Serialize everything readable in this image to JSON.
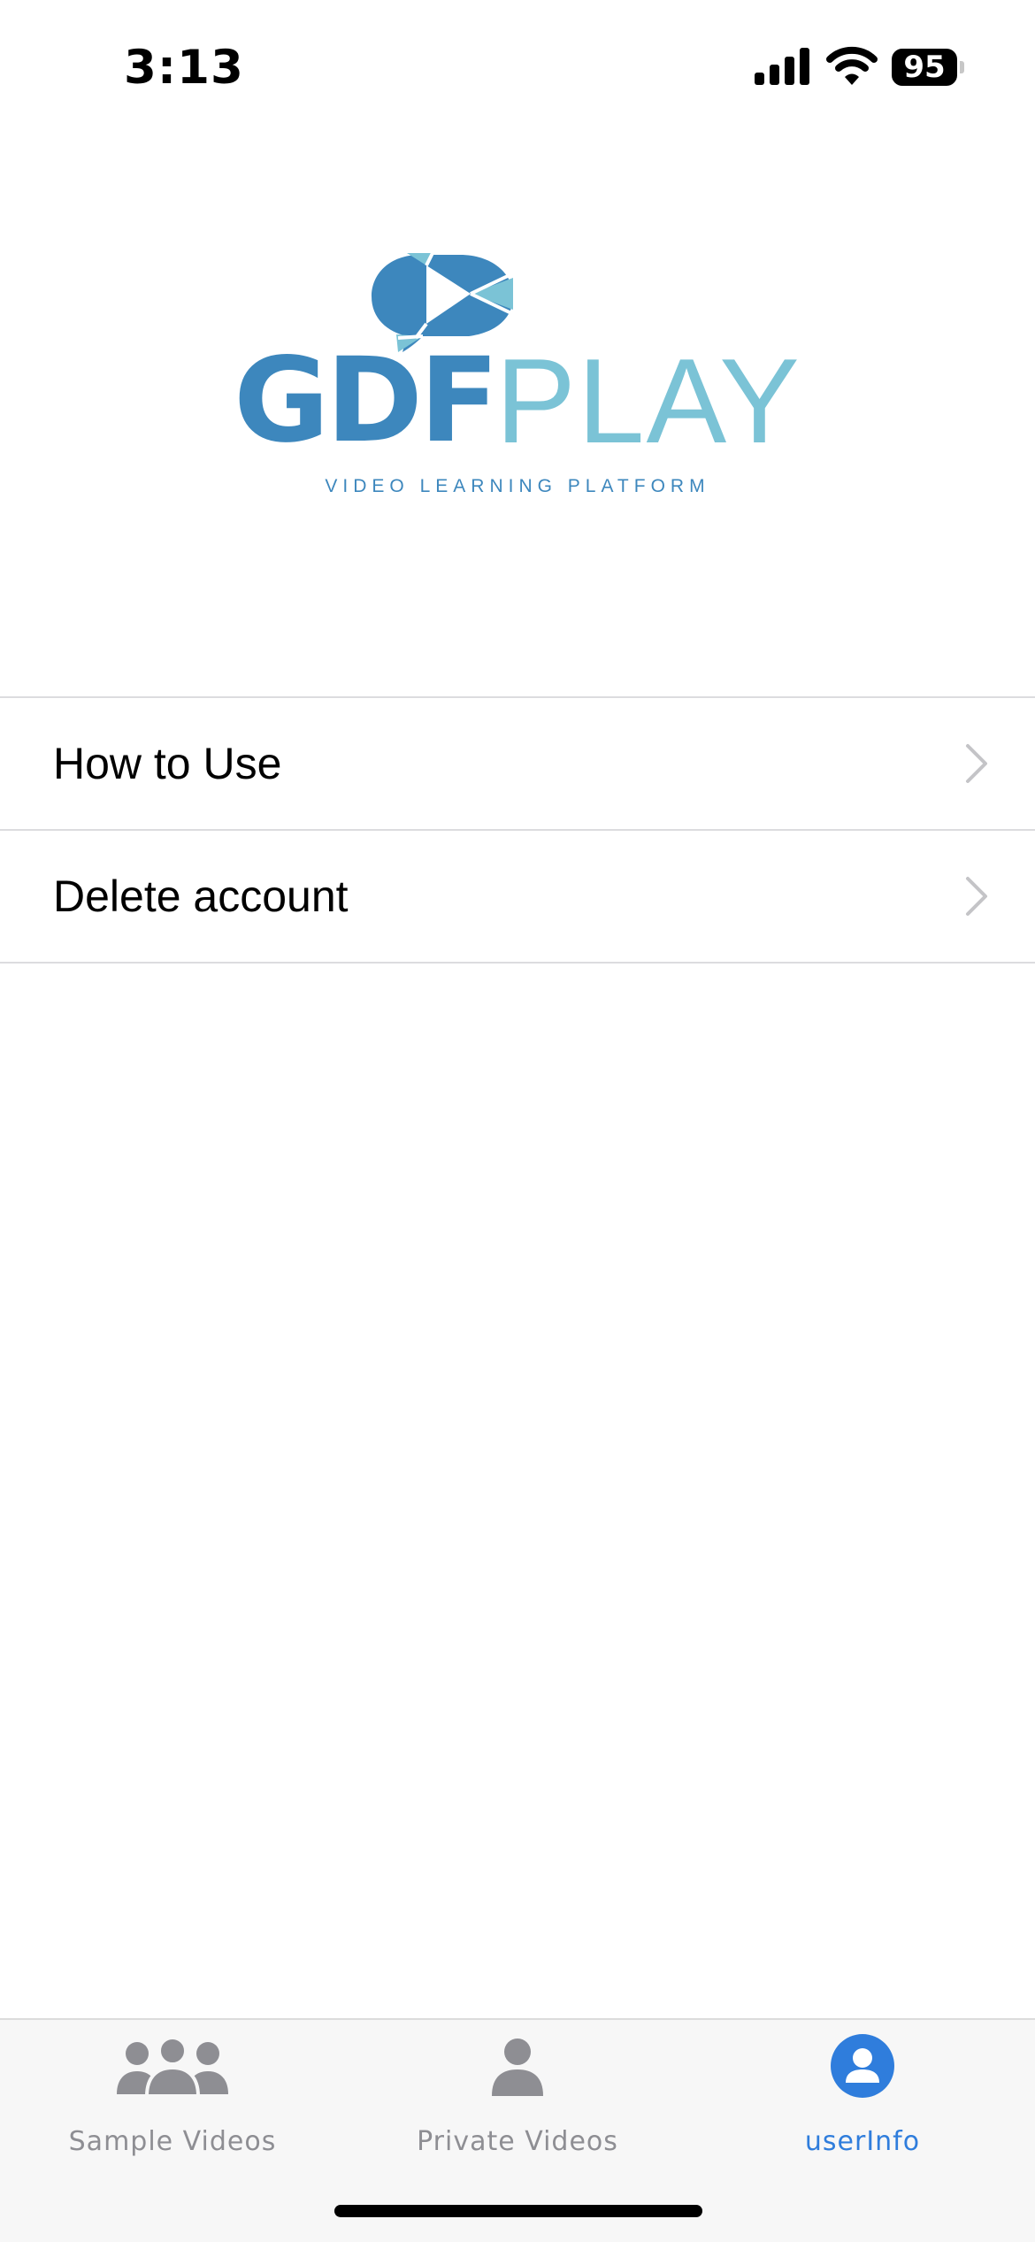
{
  "status_bar": {
    "time": "3:13",
    "battery_level": "95",
    "icons": [
      "signal-icon",
      "wifi-icon",
      "battery-icon"
    ]
  },
  "logo": {
    "brand_bold": "GDF",
    "brand_light": "PLAY",
    "tagline": "VIDEO LEARNING PLATFORM",
    "colors": {
      "dark_blue": "#3d87bd",
      "light_blue": "#7bc3d6"
    }
  },
  "menu": {
    "items": [
      {
        "label": "How to Use",
        "icon": "chevron-right-icon"
      },
      {
        "label": "Delete account",
        "icon": "chevron-right-icon"
      }
    ]
  },
  "tab_bar": {
    "tabs": [
      {
        "label": "Sample Videos",
        "icon": "group-icon",
        "active": false
      },
      {
        "label": "Private Videos",
        "icon": "person-icon",
        "active": false
      },
      {
        "label": "userInfo",
        "icon": "user-circle-icon",
        "active": true
      }
    ],
    "active_color": "#2f7ddc",
    "inactive_color": "#8e8e93"
  }
}
